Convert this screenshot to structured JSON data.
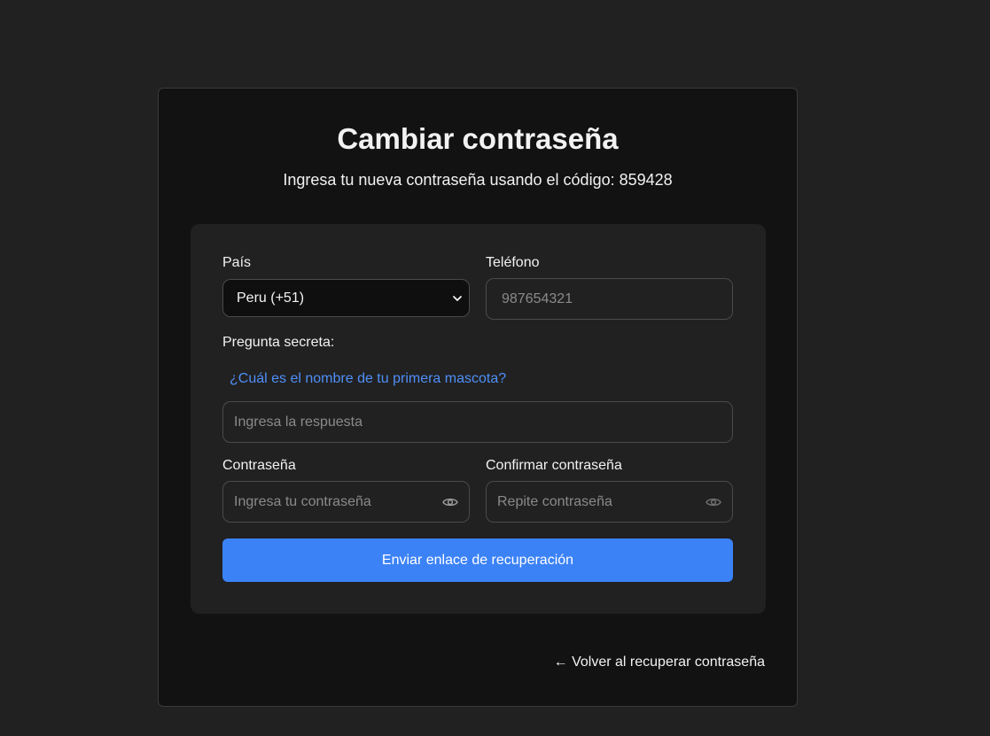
{
  "header": {
    "title": "Cambiar contraseña",
    "subtitle": "Ingresa tu nueva contraseña usando el código: 859428"
  },
  "form": {
    "country": {
      "label": "País",
      "selected": "Peru (+51)"
    },
    "phone": {
      "label": "Teléfono",
      "placeholder": "987654321"
    },
    "secret_question": {
      "label": "Pregunta secreta:",
      "question": "¿Cuál es el nombre de tu primera mascota?",
      "answer_placeholder": "Ingresa la respuesta"
    },
    "password": {
      "label": "Contraseña",
      "placeholder": "Ingresa tu contraseña"
    },
    "confirm_password": {
      "label": "Confirmar contraseña",
      "placeholder": "Repite contraseña"
    },
    "submit_label": "Enviar enlace de recuperación"
  },
  "footer": {
    "back_link": "← Volver al recuperar contraseña"
  },
  "colors": {
    "accent": "#3b82f6",
    "link": "#4f8ff7",
    "page_bg": "#212121",
    "card_bg": "#121212"
  },
  "icons": {
    "select_arrow": "chevron-down-icon",
    "password_toggle": "eye-icon"
  }
}
